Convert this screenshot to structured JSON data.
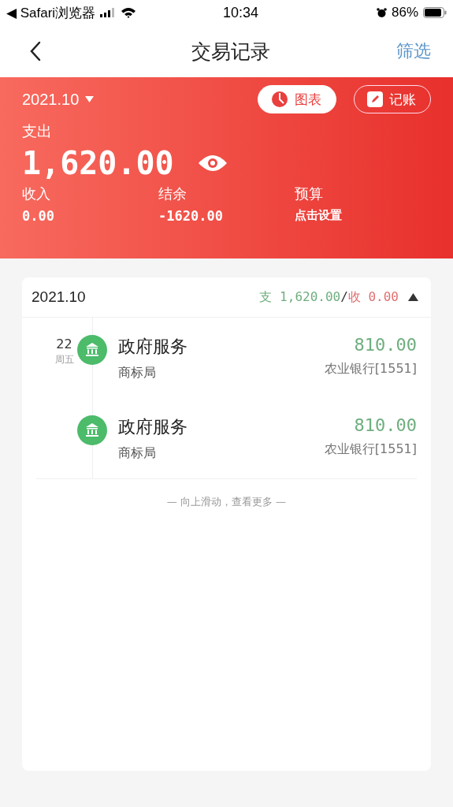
{
  "status_bar": {
    "back_app": "◀ Safari浏览器",
    "time": "10:34",
    "battery": "86%"
  },
  "nav": {
    "title": "交易记录",
    "action": "筛选"
  },
  "header": {
    "period": "2021.10",
    "buttons": [
      {
        "label": "图表",
        "kind": "chart"
      },
      {
        "label": "记账",
        "kind": "edit"
      }
    ],
    "expense_label": "支出",
    "expense": "1,620.00",
    "stats": [
      {
        "label": "收入",
        "value": "0.00"
      },
      {
        "label": "结余",
        "value": "-1620.00"
      },
      {
        "label": "预算",
        "value": "点击设置"
      }
    ]
  },
  "group": {
    "period": "2021.10",
    "expense_label": "支",
    "expense": "1,620.00",
    "separator": "/",
    "income_label": "收",
    "income": "0.00",
    "expanded": true,
    "days": [
      {
        "day": "22",
        "weekday": "周五",
        "items": [
          {
            "category": "政府服务",
            "note": "商标局",
            "amount": "810.00",
            "account": "农业银行[1551]"
          },
          {
            "category": "政府服务",
            "note": "商标局",
            "amount": "810.00",
            "account": "农业银行[1551]"
          }
        ]
      }
    ],
    "hint": "— 向上滑动，查看更多 —"
  }
}
